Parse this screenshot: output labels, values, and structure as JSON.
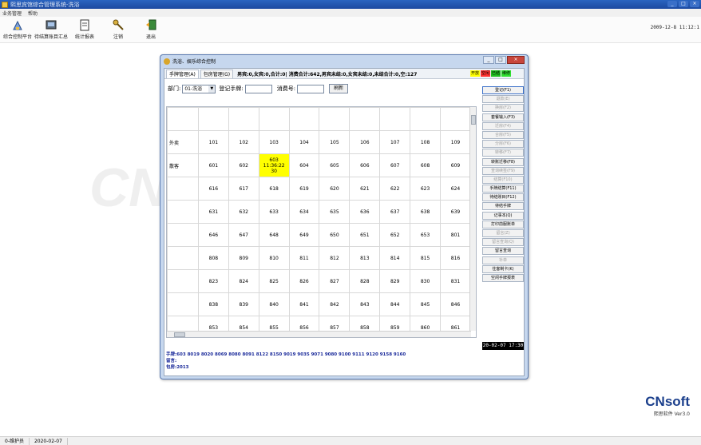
{
  "window": {
    "title": "熙思宾馆综合管理系统-洗浴"
  },
  "menu": [
    "业务管理",
    "帮助"
  ],
  "toolbar": [
    {
      "label": "综合控制平台",
      "icon": "control-platform-icon"
    },
    {
      "label": "待结算账目汇总",
      "icon": "pending-account-icon"
    },
    {
      "label": "统计报表",
      "icon": "report-icon"
    },
    {
      "label": "注销",
      "icon": "logout-key-icon"
    },
    {
      "label": "退出",
      "icon": "exit-icon"
    }
  ],
  "datetime": "2009-12-8 11:12:1",
  "watermark": "CN",
  "dialog": {
    "title": "洗浴、娱乐综合控制",
    "tabs": [
      "手牌管理(A)",
      "包房管理(G)"
    ],
    "stats": "男宾:0,女宾:0,合计:0| 消费合计:642,男宾未结:0,女宾未结:0,未结合计:0,空:127",
    "legend": [
      {
        "label": "开放",
        "color": "#ffff00"
      },
      {
        "label": "空闲",
        "color": "#ff3030"
      },
      {
        "label": "已结",
        "color": "#20c020"
      },
      {
        "label": "维修",
        "color": "#30e030"
      }
    ],
    "dept_label": "部门:",
    "dept_value": "01-洗浴",
    "register_label": "登记手牌:",
    "consume_label": "消费号:",
    "refresh_label": "刷新",
    "rows": [
      {
        "label": "",
        "cells": [
          "",
          "",
          "",
          "",
          "",
          "",
          "",
          "",
          ""
        ]
      },
      {
        "label": "外卖",
        "cells": [
          "101",
          "102",
          "103",
          "104",
          "105",
          "106",
          "107",
          "108",
          "109"
        ]
      },
      {
        "label": "散客",
        "cells": [
          "601",
          "602",
          "603\n11:36:22\n30",
          "604",
          "605",
          "606",
          "607",
          "608",
          "609"
        ]
      },
      {
        "label": "",
        "cells": [
          "616",
          "617",
          "618",
          "619",
          "620",
          "621",
          "622",
          "623",
          "624"
        ]
      },
      {
        "label": "",
        "cells": [
          "631",
          "632",
          "633",
          "634",
          "635",
          "636",
          "637",
          "638",
          "639"
        ]
      },
      {
        "label": "",
        "cells": [
          "646",
          "647",
          "648",
          "649",
          "650",
          "651",
          "652",
          "653",
          "801"
        ]
      },
      {
        "label": "",
        "cells": [
          "808",
          "809",
          "810",
          "811",
          "812",
          "813",
          "814",
          "815",
          "816"
        ]
      },
      {
        "label": "",
        "cells": [
          "823",
          "824",
          "825",
          "826",
          "827",
          "828",
          "829",
          "830",
          "831"
        ]
      },
      {
        "label": "",
        "cells": [
          "838",
          "839",
          "840",
          "841",
          "842",
          "843",
          "844",
          "845",
          "846"
        ]
      },
      {
        "label": "",
        "cells": [
          "853",
          "854",
          "855",
          "856",
          "857",
          "858",
          "859",
          "860",
          "861"
        ]
      }
    ],
    "buttons": [
      {
        "label": "登记(F1)",
        "enabled": true
      },
      {
        "label": "退款(E)",
        "enabled": false
      },
      {
        "label": "换房(F2)",
        "enabled": false
      },
      {
        "label": "套餐输入(F3)",
        "enabled": true
      },
      {
        "label": "迁房(F4)",
        "enabled": false
      },
      {
        "label": "合房(F5)",
        "enabled": false
      },
      {
        "label": "分房(F6)",
        "enabled": false
      },
      {
        "label": "转移(F7)",
        "enabled": false
      },
      {
        "label": "转账迁移(F8)",
        "enabled": true
      },
      {
        "label": "查询续签(F9)",
        "enabled": false
      },
      {
        "label": "结算(F10)",
        "enabled": false
      },
      {
        "label": "手牌结算(F11)",
        "enabled": true
      },
      {
        "label": "待结账目(F12)",
        "enabled": true
      },
      {
        "label": "待结手牌",
        "enabled": true
      },
      {
        "label": "记事本(Q)",
        "enabled": true
      },
      {
        "label": "打印前服账单",
        "enabled": true
      },
      {
        "label": "留言(Z)",
        "enabled": false
      },
      {
        "label": "留言查询(Q)",
        "enabled": false
      },
      {
        "label": "留言查询",
        "enabled": true
      },
      {
        "label": "补单",
        "enabled": false
      },
      {
        "label": "住客制卡(K)",
        "enabled": true
      },
      {
        "label": "空闲手牌报表",
        "enabled": true
      }
    ],
    "clock": "20-02-07 17:30",
    "info": [
      "手牌:603 8019 8020 8069 8080 8091 8122 8150 9019 9035 9071 9080 9100 9111 9120 9158 9160",
      "留言:",
      "包房:2013"
    ]
  },
  "brand": {
    "name": "CNsoft",
    "sub": "熙思软件 Ver3.0"
  },
  "status": {
    "user": "0-维护员",
    "date": "2020-02-07"
  }
}
